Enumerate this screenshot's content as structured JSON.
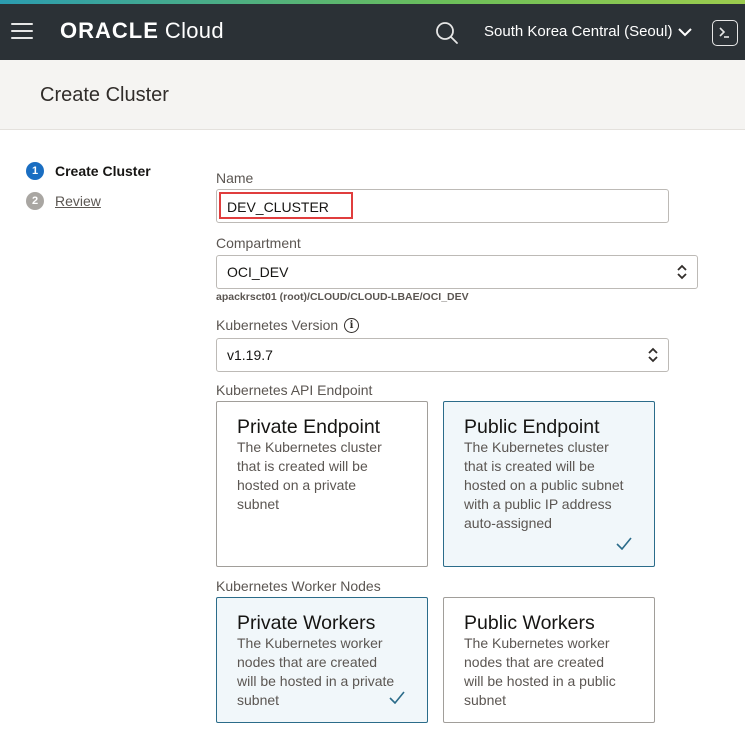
{
  "topbar": {
    "brand_oracle": "ORACLE",
    "brand_cloud": "Cloud",
    "region": "South Korea Central (Seoul)"
  },
  "page": {
    "title": "Create Cluster"
  },
  "steps": [
    {
      "number": "1",
      "label": "Create Cluster"
    },
    {
      "number": "2",
      "label": "Review"
    }
  ],
  "form": {
    "name_label": "Name",
    "name_value": "DEV_CLUSTER",
    "compartment_label": "Compartment",
    "compartment_value": "OCI_DEV",
    "compartment_path": "apackrsct01 (root)/CLOUD/CLOUD-LBAE/OCI_DEV",
    "version_label": "Kubernetes Version",
    "version_value": "v1.19.7",
    "endpoint_label": "Kubernetes API Endpoint",
    "workers_label": "Kubernetes Worker Nodes"
  },
  "endpoint_options": [
    {
      "title": "Private Endpoint",
      "description": "The Kubernetes cluster that is created will be hosted on a private subnet",
      "selected": false
    },
    {
      "title": "Public Endpoint",
      "description": "The Kubernetes cluster that is created will be hosted on a public subnet with a public IP address auto-assigned",
      "selected": true
    }
  ],
  "worker_options": [
    {
      "title": "Private Workers",
      "description": "The Kubernetes worker nodes that are created will be hosted in a private subnet",
      "selected": true
    },
    {
      "title": "Public Workers",
      "description": "The Kubernetes worker nodes that are created will be hosted in a public subnet",
      "selected": false
    }
  ],
  "colors": {
    "topbar": "#2b3136",
    "accent": "#1a6ec2",
    "selected_border": "#2b6c8a",
    "highlight": "#e03d3d"
  },
  "icons": [
    "hamburger-icon",
    "search-icon",
    "chevron-down-icon",
    "cloud-shell-icon",
    "info-icon",
    "select-chevron-icon",
    "checkmark-icon"
  ]
}
